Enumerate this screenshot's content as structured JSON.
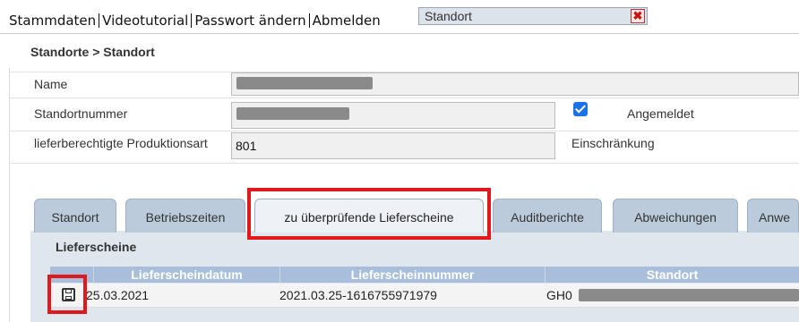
{
  "topnav": {
    "items": [
      "Stammdaten",
      "Videotutorial",
      "Passwort ändern",
      "Abmelden"
    ]
  },
  "standort_select": {
    "value": "Standort",
    "close_icon": "close-icon"
  },
  "breadcrumb": "Standorte > Standort",
  "form": {
    "name_label": "Name",
    "standortnummer_label": "Standortnummer",
    "produktionsart_label": "lieferberechtigte Produktionsart",
    "produktionsart_value": "801",
    "angemeldet_label": "Angemeldet",
    "angemeldet_checked": true,
    "einschraenkung_label": "Einschränkung"
  },
  "tabs": [
    {
      "label": "Standort"
    },
    {
      "label": "Betriebszeiten"
    },
    {
      "label": "zu überprüfende Lieferscheine",
      "active": true
    },
    {
      "label": "Auditberichte"
    },
    {
      "label": "Abweichungen"
    },
    {
      "label": "Anwe"
    }
  ],
  "section_title": "Lieferscheine",
  "table": {
    "columns": [
      "Lieferscheindatum",
      "Lieferscheinnummer",
      "Standort"
    ],
    "rows": [
      {
        "datum": "25.03.2021",
        "nummer": "2021.03.25-1616755971979",
        "standort": "GH0"
      }
    ]
  },
  "colors": {
    "highlight": "#e0191c",
    "checkbox": "#1a73e8",
    "tab": "#bccbdc",
    "table_header": "#a8bedb"
  }
}
